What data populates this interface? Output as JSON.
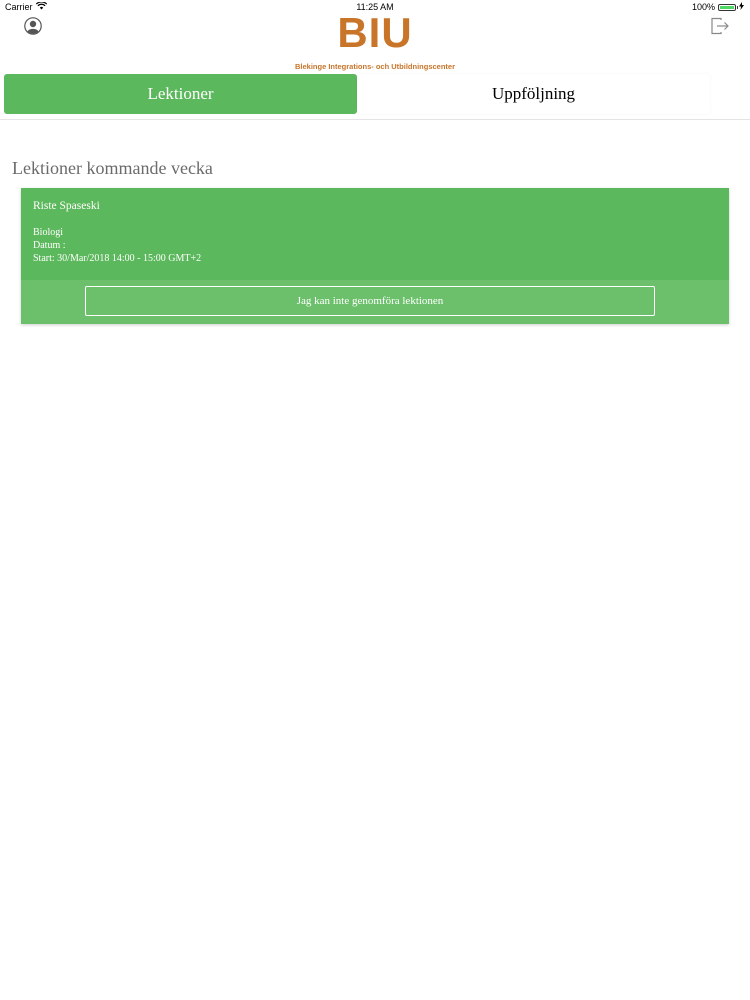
{
  "status_bar": {
    "carrier": "Carrier",
    "time": "11:25 AM",
    "battery": "100%",
    "battery_level": 1.0
  },
  "header": {
    "logo_text": "BIU",
    "logo_subtitle": "Blekinge Integrations- och Utbildningscenter",
    "profile_icon": "person-circle-icon",
    "logout_icon": "logout-icon"
  },
  "tabs": [
    {
      "label": "Lektioner",
      "active": true
    },
    {
      "label": "Uppföljning",
      "active": false
    }
  ],
  "section": {
    "title": "Lektioner kommande vecka"
  },
  "lessons": [
    {
      "teacher": "Riste Spaseski",
      "subject": "Biologi",
      "date_label": "Datum :",
      "start": "Start: 30/Mar/2018 14:00 - 15:00 GMT+2",
      "cancel_label": "Jag kan inte genomföra lektionen"
    }
  ],
  "colors": {
    "brand": "#c8752a",
    "accent": "#5cb85c"
  }
}
